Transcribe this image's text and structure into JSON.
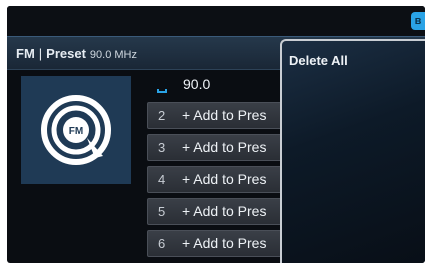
{
  "status_bar": {
    "bluetooth_icon": "bluetooth-icon",
    "accent": "#2aa3e6"
  },
  "header": {
    "band": "FM",
    "separator": "|",
    "mode": "Preset",
    "frequency": "90.0 MHz"
  },
  "album_art": {
    "icon": "fm-radio-icon",
    "label": "FM"
  },
  "current_preset": {
    "value": "90.0"
  },
  "presets": [
    {
      "number": "2",
      "label": "+ Add to Pres"
    },
    {
      "number": "3",
      "label": "+ Add to Pres"
    },
    {
      "number": "4",
      "label": "+ Add to Pres"
    },
    {
      "number": "5",
      "label": "+ Add to Pres"
    },
    {
      "number": "6",
      "label": "+ Add to Pres"
    }
  ],
  "popup": {
    "items": [
      {
        "label": "Delete All"
      }
    ]
  }
}
